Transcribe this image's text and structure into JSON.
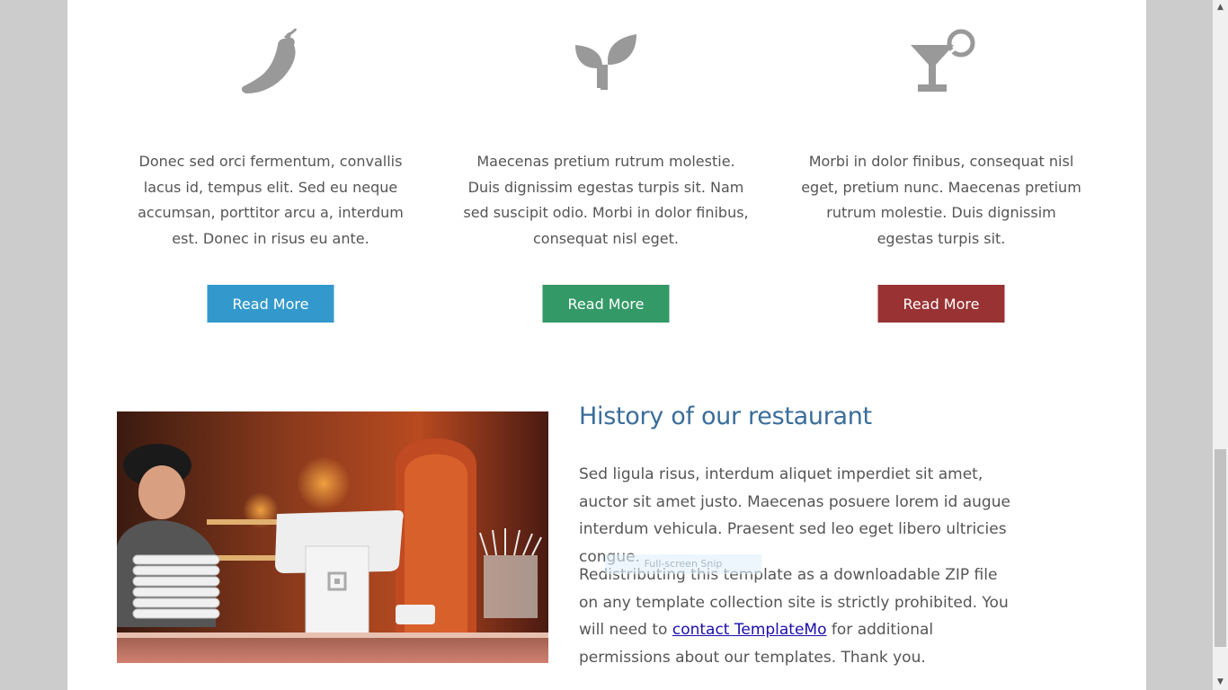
{
  "features": [
    {
      "icon": "chili-pepper-icon",
      "text": "Donec sed orci fermentum, convallis lacus id, tempus elit. Sed eu neque accumsan, porttitor arcu a, interdum est. Donec in risus eu ante.",
      "button_label": "Read More",
      "button_color": "#3399cc"
    },
    {
      "icon": "sprout-icon",
      "text": "Maecenas pretium rutrum molestie. Duis dignissim egestas turpis sit. Nam sed suscipit odio. Morbi in dolor finibus, consequat nisl eget.",
      "button_label": "Read More",
      "button_color": "#339966"
    },
    {
      "icon": "cocktail-glass-icon",
      "text": "Morbi in dolor finibus, consequat nisl eget, pretium nunc. Maecenas pretium rutrum molestie. Duis dignissim egestas turpis sit.",
      "button_label": "Read More",
      "button_color": "#993333"
    }
  ],
  "history": {
    "title": "History of our restaurant",
    "paragraph1": "Sed ligula risus, interdum aliquet imperdiet sit amet, auctor sit amet justo. Maecenas posuere lorem id augue interdum vehicula. Praesent sed leo eget libero ultricies congue.",
    "paragraph2_before": "Redistributing this template as a downloadable ZIP file on any template collection site is strictly prohibited. You will need to ",
    "paragraph2_link": "contact TemplateMo",
    "paragraph2_after": " for additional permissions about our templates. Thank you.",
    "image": "restaurant-counter-photo"
  },
  "overlay": {
    "snip_label": "Full-screen Snip"
  },
  "colors": {
    "icon": "#999999",
    "title": "#3a6d9a",
    "link": "#1a0dab"
  }
}
